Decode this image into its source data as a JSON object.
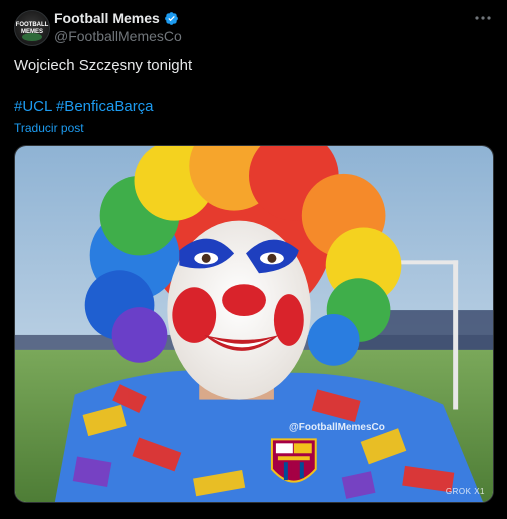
{
  "author": {
    "display_name": "Football Memes",
    "handle": "@FootballMemesCo",
    "avatar_text_top": "FOOTBALL",
    "avatar_text_bottom": "MEMES",
    "verified": true
  },
  "tweet": {
    "text": "Wojciech Szczęsny tonight",
    "hashtags": [
      "#UCL",
      "#BenficaBarça"
    ],
    "translate_label": "Traducir post"
  },
  "media": {
    "watermark": "@FootballMemesCo",
    "badge": "GROK X1",
    "alt_description_icon": "clown-photo"
  },
  "colors": {
    "background": "#000000",
    "text": "#e7e9ea",
    "secondary": "#71767b",
    "link": "#1d9bf0",
    "verified": "#1d9bf0"
  },
  "icons": {
    "more": "more-horizontal-icon",
    "verified": "verified-badge-icon"
  }
}
